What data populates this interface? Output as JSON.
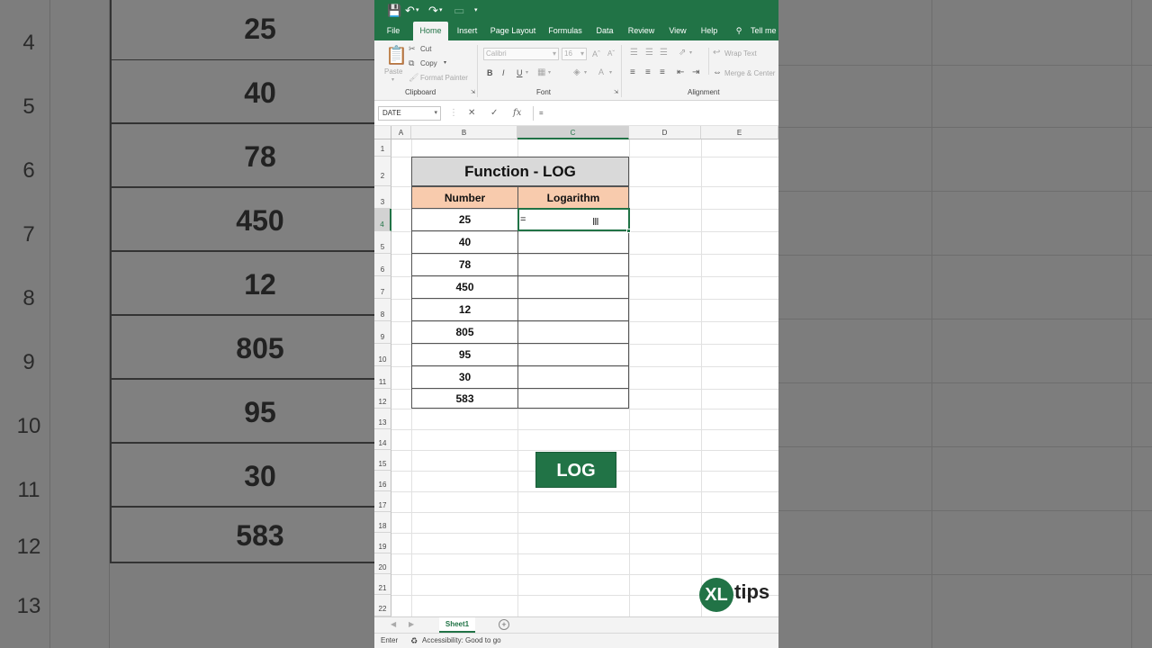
{
  "background": {
    "rows": [
      {
        "num": "4",
        "value": "25"
      },
      {
        "num": "5",
        "value": "40"
      },
      {
        "num": "6",
        "value": "78"
      },
      {
        "num": "7",
        "value": "450"
      },
      {
        "num": "8",
        "value": "12"
      },
      {
        "num": "9",
        "value": "805"
      },
      {
        "num": "10",
        "value": "95"
      },
      {
        "num": "11",
        "value": "30"
      },
      {
        "num": "12",
        "value": "583"
      },
      {
        "num": "13",
        "value": ""
      }
    ]
  },
  "ribbon": {
    "tabs": [
      "File",
      "Home",
      "Insert",
      "Page Layout",
      "Formulas",
      "Data",
      "Review",
      "View",
      "Help",
      "Tell me w"
    ],
    "active_tab": "Home",
    "clipboard": {
      "paste": "Paste",
      "cut": "Cut",
      "copy": "Copy",
      "format_painter": "Format Painter",
      "group": "Clipboard"
    },
    "font": {
      "name": "Calibri",
      "size": "16",
      "bold": "B",
      "italic": "I",
      "underline": "U",
      "group": "Font"
    },
    "alignment": {
      "wrap": "Wrap Text",
      "merge": "Merge & Center",
      "group": "Alignment"
    }
  },
  "formula_bar": {
    "name_box": "DATE",
    "cancel": "✕",
    "enter": "✓",
    "fx": "fx",
    "formula": "="
  },
  "columns": [
    "A",
    "B",
    "C",
    "D",
    "E"
  ],
  "rows": [
    "1",
    "2",
    "3",
    "4",
    "5",
    "6",
    "7",
    "8",
    "9",
    "10",
    "11",
    "12",
    "13",
    "14",
    "15",
    "16",
    "17",
    "18",
    "19",
    "20",
    "21",
    "22"
  ],
  "table": {
    "title": "Function - LOG",
    "headers": {
      "number": "Number",
      "logarithm": "Logarithm"
    },
    "numbers": [
      "25",
      "40",
      "78",
      "450",
      "12",
      "805",
      "95",
      "30",
      "583"
    ],
    "active_entry": "="
  },
  "log_button": "LOG",
  "logo": {
    "mark": "XL",
    "text": "tips"
  },
  "sheets": {
    "active": "Sheet1",
    "add": "+"
  },
  "status": {
    "mode": "Enter",
    "accessibility": "Accessibility: Good to go"
  },
  "colors": {
    "excel_green": "#217346",
    "header_fill": "#f8cbad",
    "title_fill": "#d9d9d9"
  }
}
